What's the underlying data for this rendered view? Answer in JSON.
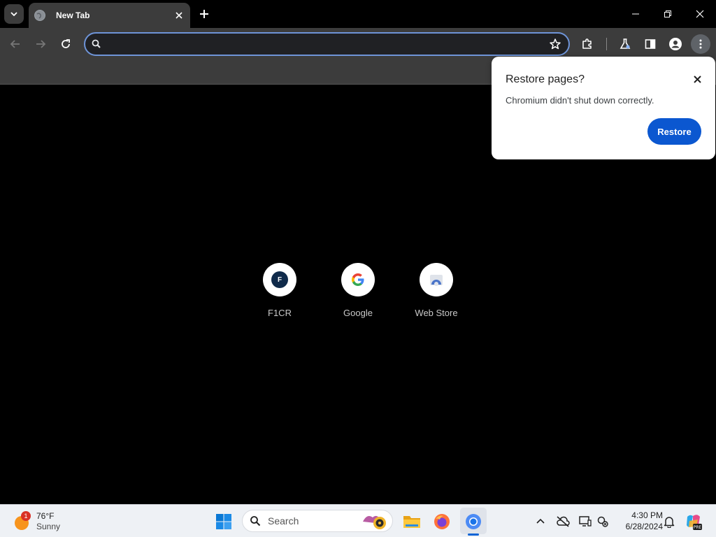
{
  "browser": {
    "tab": {
      "title": "New Tab"
    },
    "omnibox": {
      "value": "",
      "placeholder": ""
    }
  },
  "shortcuts": [
    {
      "label": "F1CR",
      "icon_letter": "F"
    },
    {
      "label": "Google"
    },
    {
      "label": "Web Store"
    }
  ],
  "restore_popup": {
    "title": "Restore pages?",
    "message": "Chromium didn't shut down correctly.",
    "button_label": "Restore"
  },
  "taskbar": {
    "weather": {
      "temperature": "76°F",
      "condition": "Sunny",
      "badge": "1"
    },
    "search_label": "Search",
    "clock": {
      "time": "4:30 PM",
      "date": "6/28/2024"
    }
  },
  "colors": {
    "accent_blue": "#0b57d0",
    "omnibox_border": "#6e94d8",
    "toolbar_bg": "#3c3c3c"
  }
}
